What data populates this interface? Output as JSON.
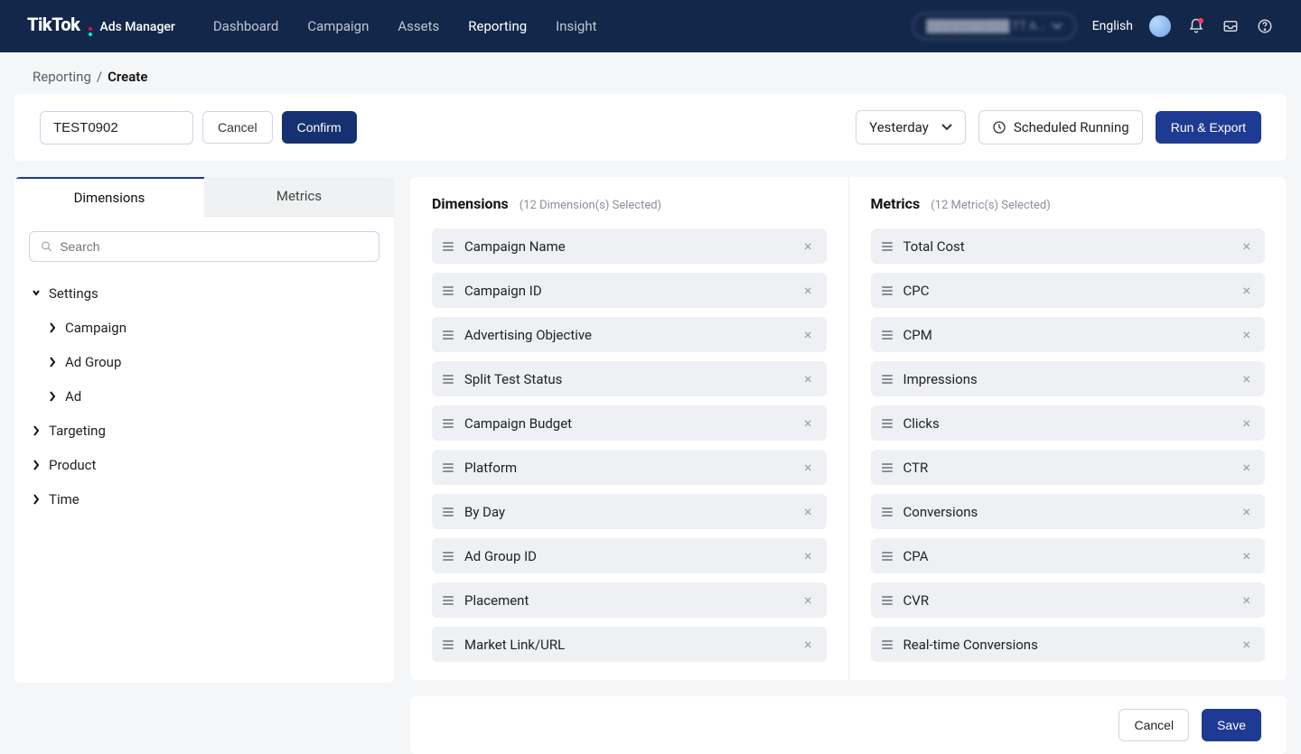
{
  "header": {
    "brand_main": "TikTok",
    "brand_sub": "Ads Manager",
    "nav": [
      "Dashboard",
      "Campaign",
      "Assets",
      "Reporting",
      "Insight"
    ],
    "active_nav_index": 3,
    "account_placeholder": "██████████ TT A...",
    "language": "English"
  },
  "breadcrumb": {
    "parent": "Reporting",
    "sep": "/",
    "current": "Create"
  },
  "toolbar": {
    "name_value": "TEST0902",
    "cancel_label": "Cancel",
    "confirm_label": "Confirm",
    "date_label": "Yesterday",
    "schedule_label": "Scheduled Running",
    "run_export_label": "Run & Export"
  },
  "sidebar": {
    "tabs": {
      "dimensions": "Dimensions",
      "metrics": "Metrics"
    },
    "active_tab": "dimensions",
    "search_placeholder": "Search",
    "tree": {
      "settings": {
        "label": "Settings",
        "expanded": true,
        "children": {
          "campaign": {
            "label": "Campaign"
          },
          "adgroup": {
            "label": "Ad Group"
          },
          "ad": {
            "label": "Ad"
          }
        }
      },
      "targeting": {
        "label": "Targeting"
      },
      "product": {
        "label": "Product"
      },
      "time": {
        "label": "Time"
      }
    }
  },
  "selections": {
    "dimensions": {
      "title": "Dimensions",
      "count_text": "(12 Dimension(s) Selected)",
      "items": [
        "Campaign Name",
        "Campaign ID",
        "Advertising Objective",
        "Split Test Status",
        "Campaign Budget",
        "Platform",
        "By Day",
        "Ad Group ID",
        "Placement",
        "Market Link/URL"
      ]
    },
    "metrics": {
      "title": "Metrics",
      "count_text": "(12 Metric(s) Selected)",
      "items": [
        "Total Cost",
        "CPC",
        "CPM",
        "Impressions",
        "Clicks",
        "CTR",
        "Conversions",
        "CPA",
        "CVR",
        "Real-time Conversions"
      ]
    }
  },
  "footer": {
    "cancel_label": "Cancel",
    "save_label": "Save"
  }
}
